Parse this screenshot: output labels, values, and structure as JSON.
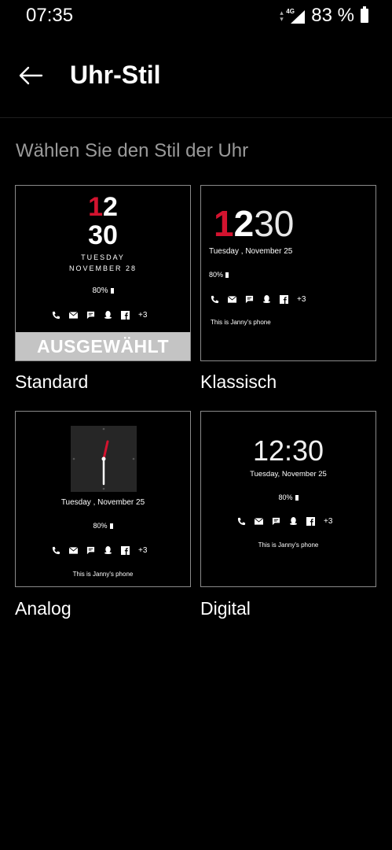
{
  "status_bar": {
    "time": "07:35",
    "network_label": "4G",
    "battery_percent": "83 %"
  },
  "header": {
    "title": "Uhr-Stil"
  },
  "section": {
    "label": "Wählen Sie den Stil der Uhr"
  },
  "cards": [
    {
      "name": "Standard",
      "selected_label": "AUSGEWÄHLT",
      "preview": {
        "hour_first": "1",
        "hour_second": "2",
        "minutes": "30",
        "weekday": "TUESDAY",
        "date": "NOVEMBER 28",
        "battery": "80%",
        "extra_count": "+3"
      }
    },
    {
      "name": "Klassisch",
      "preview": {
        "hour_first": "1",
        "hour_second": "2",
        "minutes": "30",
        "date": "Tuesday , November  25",
        "battery": "80%",
        "extra_count": "+3",
        "owner": "This is Janny's phone"
      }
    },
    {
      "name": "Analog",
      "preview": {
        "date": "Tuesday , November  25",
        "battery": "80%",
        "extra_count": "+3",
        "owner": "This is Janny's phone"
      }
    },
    {
      "name": "Digital",
      "preview": {
        "time": "12:30",
        "date": "Tuesday, November  25",
        "battery": "80%",
        "extra_count": "+3",
        "owner": "This is Janny's phone"
      }
    }
  ],
  "colors": {
    "background": "#000000",
    "accent_red": "#d3132f",
    "card_border": "#8a8a8a",
    "selected_banner": "#c4c4c4",
    "section_text": "#9a9a9a"
  },
  "icons": [
    "phone-icon",
    "mail-icon",
    "message-icon",
    "qq-icon",
    "facebook-icon"
  ]
}
